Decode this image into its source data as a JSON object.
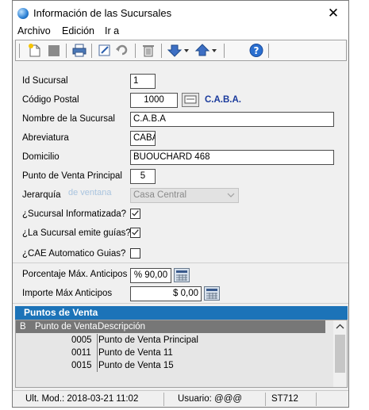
{
  "window": {
    "title": "Información de las Sucursales",
    "close_glyph": "✕"
  },
  "menu": [
    "Archivo",
    "Edición",
    "Ir a"
  ],
  "toolbar": {
    "icons": [
      "new-document-icon",
      "save-icon",
      "print-icon",
      "edit-icon",
      "undo-icon",
      "delete-icon",
      "arrow-down-icon",
      "arrow-up-icon",
      "help-icon"
    ]
  },
  "form": {
    "id_sucursal": {
      "label": "Id Sucursal",
      "value": "1"
    },
    "codigo_postal": {
      "label": "Código Postal",
      "value": "1000",
      "city": "C.A.B.A."
    },
    "nombre": {
      "label": "Nombre de la Sucursal",
      "value": "C.A.B.A"
    },
    "abreviatura": {
      "label": "Abreviatura",
      "value": "CABA"
    },
    "domicilio": {
      "label": "Domicilio",
      "value": "BUOUCHARD 468"
    },
    "punto_venta": {
      "label": "Punto de Venta Principal",
      "value": "5"
    },
    "jerarquia": {
      "label": "Jerarquía",
      "value": "Casa Central",
      "ghost": "de ventana"
    },
    "informatizada": {
      "label": "¿Sucursal Informatizada?",
      "checked": true
    },
    "emite_guias": {
      "label": "¿La Sucursal emite guías?",
      "checked": true
    },
    "cae_auto": {
      "label": "¿CAE Automatico Guias?",
      "checked": false
    },
    "porcentaje": {
      "label": "Porcentaje Máx. Anticipos",
      "value": "% 90,00"
    },
    "importe": {
      "label": "Importe Máx Anticipos",
      "value": "$ 0,00"
    }
  },
  "puntos_venta": {
    "title": "Puntos de Venta",
    "columns": [
      "B",
      "Punto de Venta",
      "Descripción"
    ],
    "rows": [
      {
        "b": "",
        "punto": "0005",
        "desc": "Punto de Venta Principal"
      },
      {
        "b": "",
        "punto": "0011",
        "desc": "Punto de Venta 11"
      },
      {
        "b": "",
        "punto": "0015",
        "desc": "Punto de Venta 15"
      }
    ]
  },
  "status": {
    "modificado": "Ult. Mod.: 2018-03-21 11:02",
    "usuario": "Usuario: @@@",
    "code": "ST712"
  },
  "colors": {
    "accent": "#1c73b8",
    "link": "#1a3a9c"
  }
}
